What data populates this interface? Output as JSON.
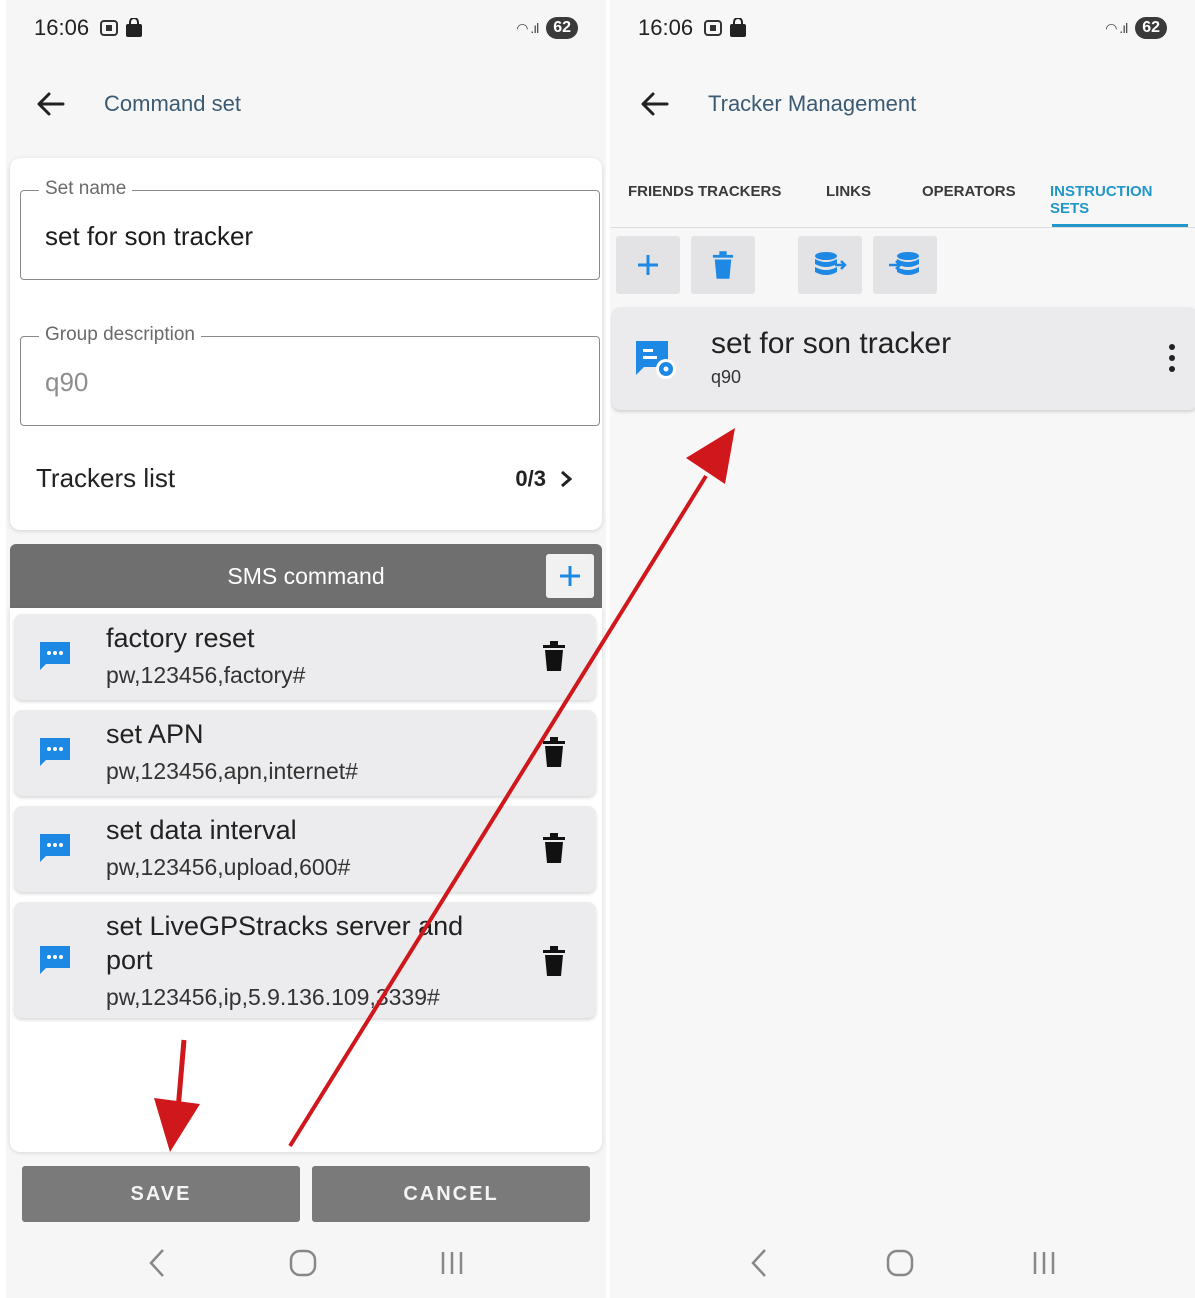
{
  "left": {
    "status": {
      "time": "16:06",
      "battery": "62"
    },
    "app_bar": {
      "title": "Command set"
    },
    "form": {
      "set_name_label": "Set name",
      "set_name_value": "set for son tracker",
      "group_desc_label": "Group description",
      "group_desc_value": "q90",
      "trackers_label": "Trackers list",
      "trackers_count": "0/3"
    },
    "sms": {
      "title": "SMS command",
      "commands": [
        {
          "name": "factory reset",
          "code": "pw,123456,factory#"
        },
        {
          "name": "set APN",
          "code": "pw,123456,apn,internet#"
        },
        {
          "name": "set data interval",
          "code": "pw,123456,upload,600#"
        },
        {
          "name_line1": "set LiveGPStracks server and",
          "name_line2": "port",
          "code": "pw,123456,ip,5.9.136.109,3339#"
        }
      ]
    },
    "buttons": {
      "save": "SAVE",
      "cancel": "CANCEL"
    }
  },
  "right": {
    "status": {
      "time": "16:06",
      "battery": "62"
    },
    "app_bar": {
      "title": "Tracker Management"
    },
    "tabs": [
      "FRIENDS TRACKERS",
      "LINKS",
      "OPERATORS",
      "INSTRUCTION SETS"
    ],
    "active_tab": "INSTRUCTION SETS",
    "set_item": {
      "name": "set for son tracker",
      "description": "q90"
    }
  },
  "colors": {
    "accent": "#2196c9",
    "icon_blue": "#1e88e5",
    "arrow_red": "#d0171b",
    "header_gray": "#6f6f6f"
  },
  "icons": [
    "back-arrow-icon",
    "plus-icon",
    "trash-icon",
    "chat-icon",
    "database-export-icon",
    "database-import-icon",
    "set-settings-icon",
    "more-vert-icon",
    "chevron-right-icon"
  ]
}
